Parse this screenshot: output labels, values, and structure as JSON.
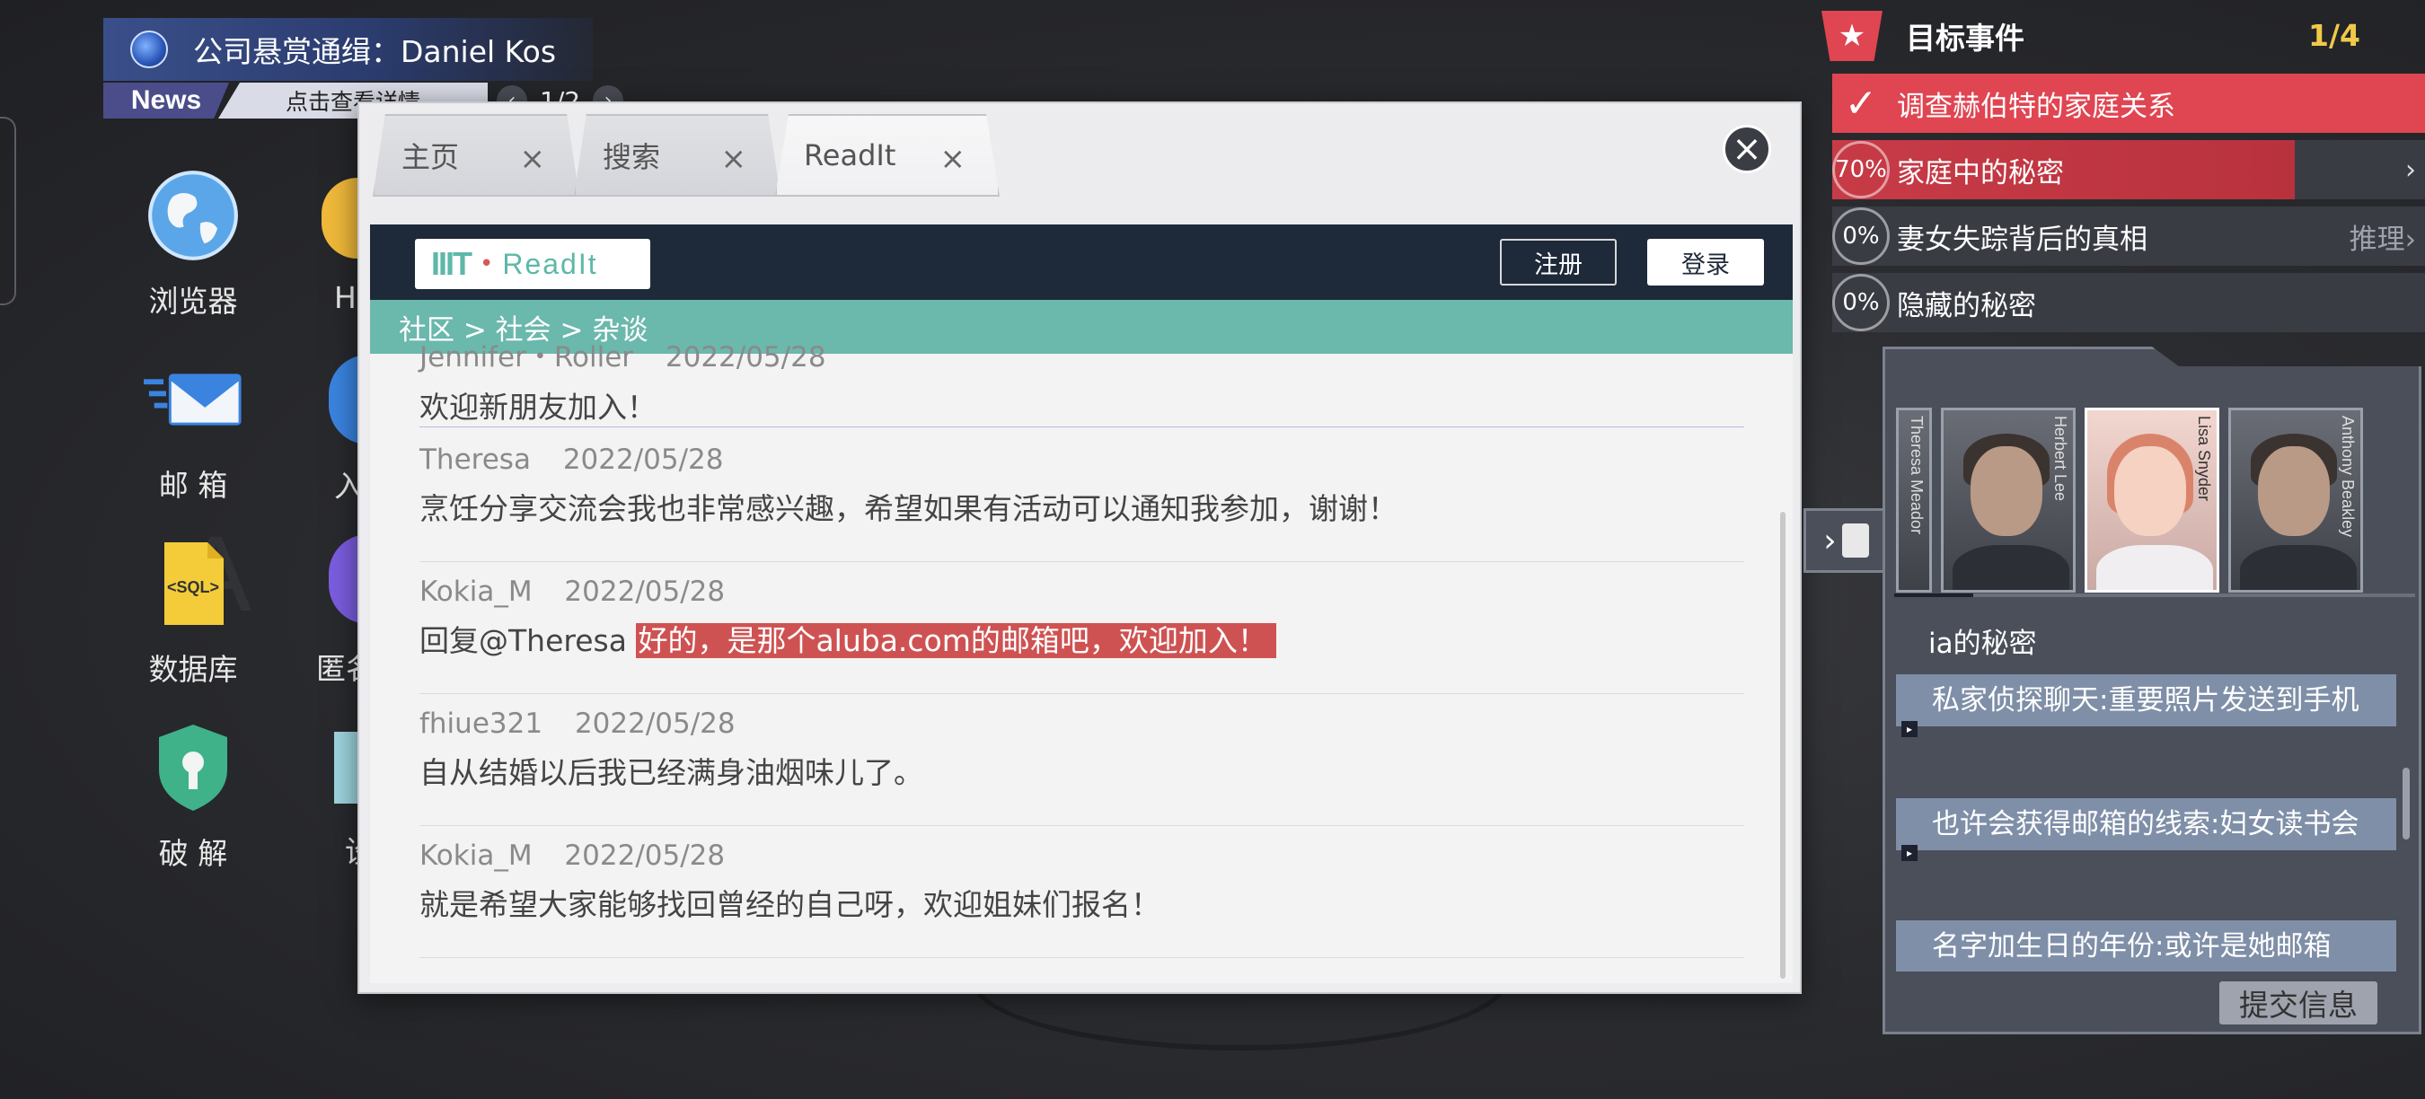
{
  "news": {
    "headline": "公司悬赏通缉：Daniel   Kos",
    "tag": "News",
    "detail": "点击查看详情",
    "pager": "1/2"
  },
  "desktop_icons": [
    {
      "label": "浏览器",
      "icon": "globe-icon"
    },
    {
      "label": "邮 箱",
      "icon": "mail-icon"
    },
    {
      "label": "数据库",
      "icon": "sql-file-icon"
    },
    {
      "label": "破 解",
      "icon": "shield-key-icon"
    }
  ],
  "partial_labels": [
    "H",
    "入",
    "匿名",
    "设"
  ],
  "browser": {
    "tabs": [
      {
        "label": "主页",
        "close": "×"
      },
      {
        "label": "搜索",
        "close": "×"
      },
      {
        "label": "ReadIt",
        "close": "×"
      }
    ],
    "close_symbol": "×",
    "site": {
      "logo_mark": "IIIT",
      "logo_dot": "•",
      "logo_name": "ReadIt",
      "register": "注册",
      "login": "登录",
      "breadcrumb": "社区 > 社会 > 杂谈"
    },
    "posts": [
      {
        "author": "Jennifer・Roller",
        "date": "2022/05/28",
        "text": "欢迎新朋友加入！"
      },
      {
        "author": "Theresa",
        "date": "2022/05/28",
        "text": "烹饪分享交流会我也非常感兴趣，希望如果有活动可以通知我参加，谢谢！"
      },
      {
        "author": "Kokia_M",
        "date": "2022/05/28",
        "reply_prefix": "回复@Theresa ",
        "highlight": "好的，是那个aluba.com的邮箱吧，欢迎加入！"
      },
      {
        "author": "fhiue321",
        "date": "2022/05/28",
        "text": "自从结婚以后我已经满身油烟味儿了。"
      },
      {
        "author": "Kokia_M",
        "date": "2022/05/28",
        "text": "就是希望大家能够找回曾经的自己呀，欢迎姐妹们报名！"
      }
    ]
  },
  "objectives": {
    "title": "目标事件",
    "count": "1/4",
    "items": [
      {
        "status": "done",
        "text": "调查赫伯特的家庭关系"
      },
      {
        "status": "progress",
        "pct": "70%",
        "text": "家庭中的秘密",
        "arrow": "›"
      },
      {
        "status": "plain",
        "pct": "0%",
        "text": "妻女失踪背后的真相",
        "extra": "推理›"
      },
      {
        "status": "plain",
        "pct": "0%",
        "text": "隐藏的秘密"
      }
    ]
  },
  "clues": {
    "portraits": [
      {
        "name": "Theresa Meador"
      },
      {
        "name": "Herbert Lee"
      },
      {
        "name": "Lisa Snyder"
      },
      {
        "name": "Anthony Beakley"
      }
    ],
    "title": "ia的秘密",
    "items": [
      "私家侦探聊天:重要照片发送到手机",
      "也许会获得邮箱的线索:妇女读书会",
      "名字加生日的年份:或许是她邮箱"
    ],
    "submit": "提交信息"
  },
  "colors": {
    "accent_red": "#e04552",
    "teal": "#6bb8ad",
    "navy": "#1e2a3a",
    "gold": "#f0c94a",
    "highlight": "#cf5252"
  }
}
